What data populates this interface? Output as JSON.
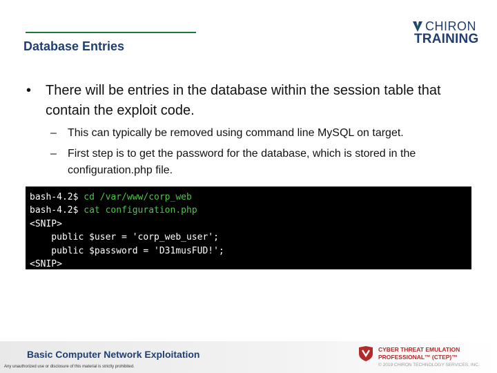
{
  "slide": {
    "title": "Database Entries"
  },
  "logo": {
    "line1": "CHIRON",
    "line2": "TRAINING"
  },
  "bullets": {
    "main": "There will be entries in the database within the session table that contain the exploit code.",
    "sub1": "This can typically be removed using command line MySQL on target.",
    "sub2": "First step is to get the password for the database, which is stored in the configuration.php file."
  },
  "terminal": {
    "lines": [
      {
        "prompt": "bash-4.2$ ",
        "command": "cd /var/www/corp_web"
      },
      {
        "prompt": "bash-4.2$ ",
        "command": "cat configuration.php"
      },
      {
        "text": "<SNIP>"
      },
      {
        "text": "    public $user = 'corp_web_user';"
      },
      {
        "text": "    public $password = 'D31musFUD!';"
      },
      {
        "text": "<SNIP>"
      }
    ]
  },
  "footer": {
    "course_title": "Basic Computer Network Exploitation",
    "legal": "Any unauthorized use or disclosure of this material is strictly prohibited.",
    "ctep_line1": "CYBER THREAT EMULATION",
    "ctep_line2": "PROFESSIONAL™ (CTEP)™",
    "copyright": "© 2019 CHIRON TECHNOLOGY SERVICES, INC."
  },
  "colors": {
    "brand_blue": "#1f3f73",
    "accent_green": "#1a7a3c",
    "terminal_cmd": "#4fc34a",
    "ctep_red": "#b22a2a"
  }
}
